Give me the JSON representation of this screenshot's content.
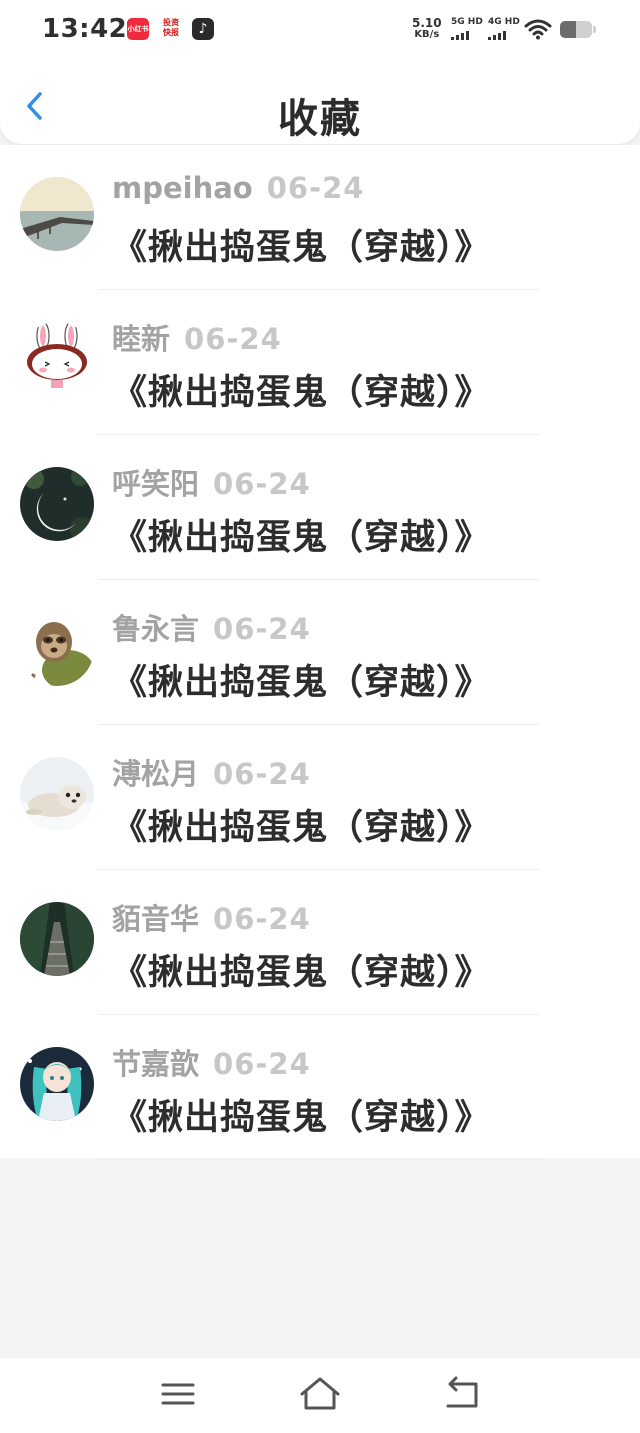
{
  "status_bar": {
    "time": "13:42",
    "apps": [
      {
        "label": "小红书",
        "icon": "xiaohongshu-icon"
      },
      {
        "label": "投资 快报",
        "icon": "news-icon"
      },
      {
        "label": "♪",
        "icon": "tiktok-icon"
      }
    ],
    "net_speed": "5.10",
    "net_unit": "KB/s",
    "signal1": "5G HD",
    "signal2": "4G HD",
    "wifi_icon": "wifi-icon",
    "battery_level": 0.5
  },
  "header": {
    "title": "收藏",
    "back_icon": "chevron-left-icon",
    "accent": "#2f8ee8"
  },
  "items": [
    {
      "name": "mpeihao",
      "date": "06-24",
      "title": "《揪出捣蛋鬼（穿越）》",
      "avatar": "pier-sea-avatar"
    },
    {
      "name": "睦新",
      "date": "06-24",
      "title": "《揪出捣蛋鬼（穿越）》",
      "avatar": "rabbit-avatar"
    },
    {
      "name": "呼笑阳",
      "date": "06-24",
      "title": "《揪出捣蛋鬼（穿越）》",
      "avatar": "moon-avatar"
    },
    {
      "name": "鲁永言",
      "date": "06-24",
      "title": "《揪出捣蛋鬼（穿越）》",
      "avatar": "sloth-avatar"
    },
    {
      "name": "溥松月",
      "date": "06-24",
      "title": "《揪出捣蛋鬼（穿越）》",
      "avatar": "seal-avatar"
    },
    {
      "name": "貊音华",
      "date": "06-24",
      "title": "《揪出捣蛋鬼（穿越）》",
      "avatar": "forest-bridge-avatar"
    },
    {
      "name": "节嘉歆",
      "date": "06-24",
      "title": "《揪出捣蛋鬼（穿越）》",
      "avatar": "anime-girl-avatar"
    }
  ],
  "nav_bar": {
    "menu_icon": "menu-icon",
    "home_icon": "home-icon",
    "back_icon": "back-icon"
  }
}
